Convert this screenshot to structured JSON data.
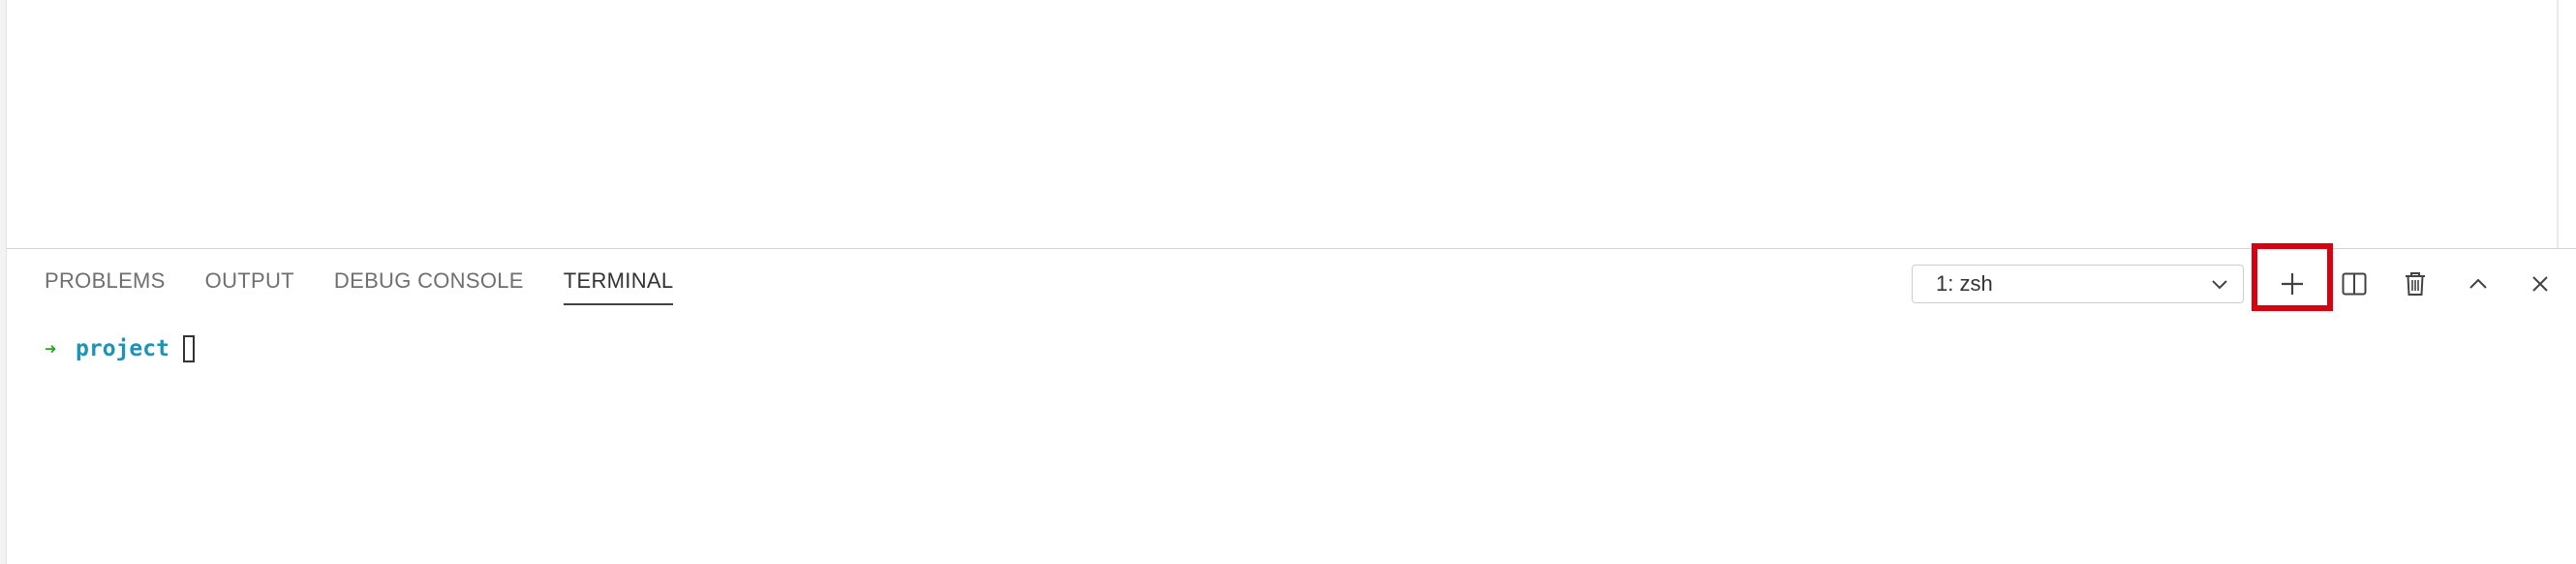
{
  "panel": {
    "tabs": [
      {
        "label": "PROBLEMS",
        "active": false
      },
      {
        "label": "OUTPUT",
        "active": false
      },
      {
        "label": "DEBUG CONSOLE",
        "active": false
      },
      {
        "label": "TERMINAL",
        "active": true
      }
    ],
    "terminal_select": {
      "selected": "1: zsh"
    },
    "actions": [
      {
        "name": "new-terminal",
        "icon": "plus-icon"
      },
      {
        "name": "split-terminal",
        "icon": "split-icon"
      },
      {
        "name": "kill-terminal",
        "icon": "trash-icon"
      },
      {
        "name": "maximize-panel",
        "icon": "chevron-up-icon"
      },
      {
        "name": "close-panel",
        "icon": "close-icon"
      }
    ]
  },
  "terminal": {
    "prompt_symbol": "➜",
    "directory": "project"
  },
  "colors": {
    "highlight": "#d9000f",
    "prompt_arrow": "#2aa32a",
    "directory": "#1a94b8"
  }
}
